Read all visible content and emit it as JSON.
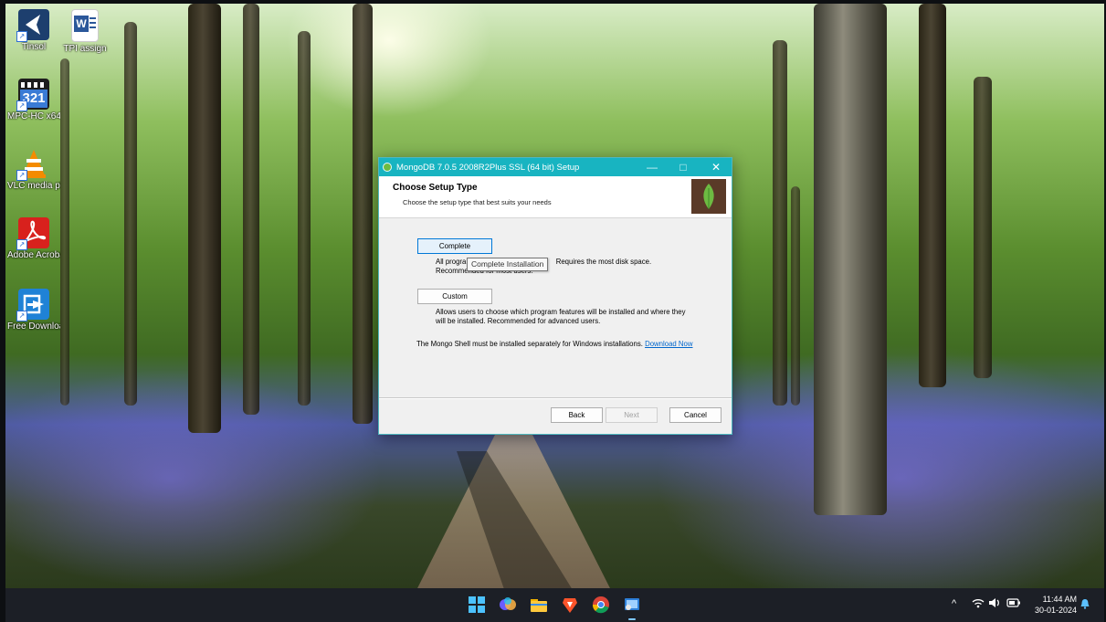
{
  "desktop_icons": [
    {
      "label": "Tinsol",
      "icon": "arrow-app-icon"
    },
    {
      "label": "TPI assign",
      "icon": "word-icon"
    },
    {
      "label": "MPC-HC x64",
      "icon": "mpc-321-icon"
    },
    {
      "label": "VLC media player",
      "icon": "vlc-cone-icon"
    },
    {
      "label": "Adobe Acrobat",
      "icon": "acrobat-icon"
    },
    {
      "label": "Free Download",
      "icon": "download-app-icon"
    }
  ],
  "window": {
    "title": "MongoDB 7.0.5 2008R2Plus SSL (64 bit) Setup",
    "controls": {
      "minimize": "—",
      "maximize": "□",
      "close": "✕"
    },
    "header_title": "Choose Setup Type",
    "header_subtitle": "Choose the setup type that best suits your needs",
    "complete_label": "Complete",
    "complete_desc_line1a": "All progra",
    "complete_desc_line1b": "Requires the most disk space.",
    "complete_desc_line2": "Recommended for most users.",
    "tooltip": "Complete Installation",
    "custom_label": "Custom",
    "custom_desc_line1": "Allows users to choose which program features will be installed and where they",
    "custom_desc_line2": "will be installed. Recommended for advanced users.",
    "shell_note": "The Mongo Shell must be installed separately for Windows installations.",
    "download_link": "Download Now",
    "back_label": "Back",
    "next_label": "Next",
    "cancel_label": "Cancel"
  },
  "taskbar": {
    "apps": [
      "windows-start-icon",
      "copilot-icon",
      "file-explorer-icon",
      "brave-icon",
      "chrome-icon",
      "installer-icon"
    ],
    "tray": {
      "chevron": "^",
      "wifi": "wifi-icon",
      "volume": "volume-icon",
      "battery": "battery-icon"
    },
    "time": "11:44 AM",
    "date": "30-01-2024"
  },
  "colors": {
    "titlebar": "#18b4c1",
    "link": "#0066cc",
    "taskbar": "#1c1f26"
  }
}
